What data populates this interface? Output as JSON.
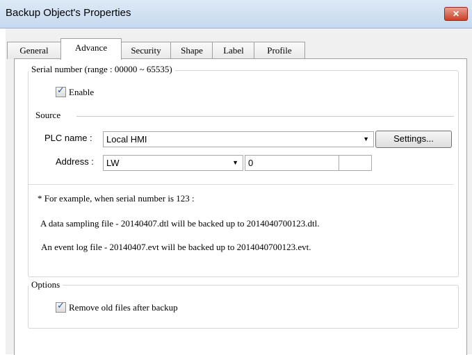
{
  "window": {
    "title": "Backup Object's Properties",
    "close_glyph": "✕"
  },
  "tabs": [
    {
      "label": "General",
      "active": false
    },
    {
      "label": "Advance",
      "active": true
    },
    {
      "label": "Security",
      "active": false
    },
    {
      "label": "Shape",
      "active": false
    },
    {
      "label": "Label",
      "active": false
    },
    {
      "label": "Profile",
      "active": false
    }
  ],
  "serial": {
    "legend": "Serial number (range : 00000 ~ 65535)",
    "enable_label": "Enable",
    "enable_checked": true,
    "source_label": "Source",
    "plc_label": "PLC name :",
    "plc_value": "Local HMI",
    "settings_button": "Settings...",
    "address_label": "Address :",
    "address_type": "LW",
    "address_value": "0",
    "example_line": "* For example, when serial number is 123 :",
    "example_dtl": "A data sampling file - 20140407.dtl will be backed up to 2014040700123.dtl.",
    "example_evt": "An event log file - 20140407.evt will be backed up to 2014040700123.evt."
  },
  "options": {
    "legend": "Options",
    "remove_label": "Remove old files after backup",
    "remove_checked": true
  },
  "icons": {
    "dropdown": "▼",
    "check": "✓"
  }
}
